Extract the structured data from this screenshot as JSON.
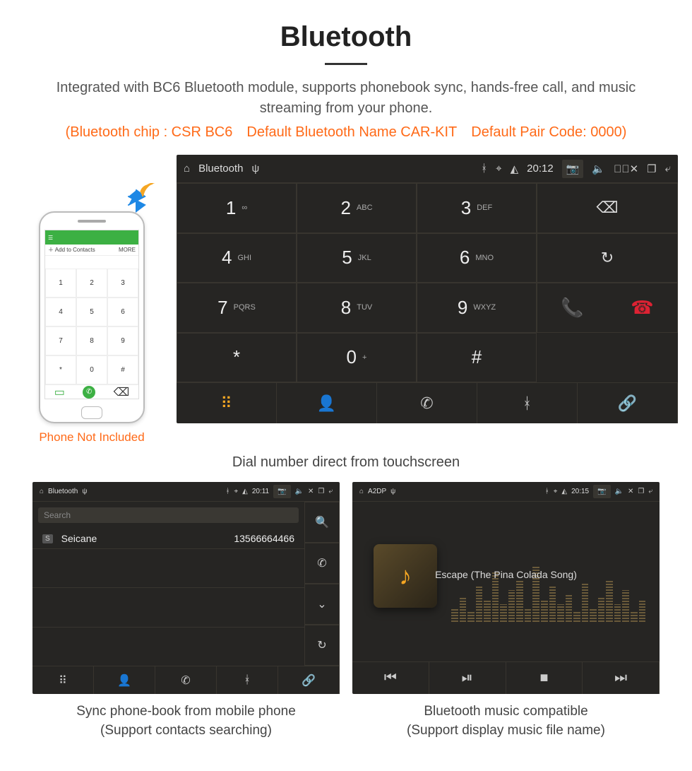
{
  "page": {
    "title": "Bluetooth",
    "subtitle": "Integrated with BC6 Bluetooth module, supports phonebook sync, hands-free call, and music streaming from your phone.",
    "spec_line": "(Bluetooth chip : CSR BC6 Default Bluetooth Name CAR-KIT Default Pair Code: 0000)"
  },
  "phone_mock": {
    "add_contacts": "Add to Contacts",
    "more": "MORE",
    "keys": [
      "1",
      "2",
      "3",
      "4",
      "5",
      "6",
      "7",
      "8",
      "9",
      "*",
      "0",
      "#"
    ],
    "caption": "Phone Not Included"
  },
  "dialer": {
    "status": {
      "title": "Bluetooth",
      "time": "20:12"
    },
    "keys": [
      {
        "n": "1",
        "l": "∞"
      },
      {
        "n": "2",
        "l": "ABC"
      },
      {
        "n": "3",
        "l": "DEF"
      },
      {
        "n": "4",
        "l": "GHI"
      },
      {
        "n": "5",
        "l": "JKL"
      },
      {
        "n": "6",
        "l": "MNO"
      },
      {
        "n": "7",
        "l": "PQRS"
      },
      {
        "n": "8",
        "l": "TUV"
      },
      {
        "n": "9",
        "l": "WXYZ"
      },
      {
        "n": "*",
        "l": ""
      },
      {
        "n": "0",
        "l": "+"
      },
      {
        "n": "#",
        "l": ""
      }
    ],
    "caption": "Dial number direct from touchscreen"
  },
  "phonebook": {
    "status": {
      "title": "Bluetooth",
      "time": "20:11"
    },
    "search_placeholder": "Search",
    "contact": {
      "name": "Seicane",
      "number": "13566664466",
      "tag": "S"
    },
    "caption_l1": "Sync phone-book from mobile phone",
    "caption_l2": "(Support contacts searching)"
  },
  "music": {
    "status": {
      "title": "A2DP",
      "time": "20:15"
    },
    "track": "Escape (The Pina Colada Song)",
    "caption_l1": "Bluetooth music compatible",
    "caption_l2": "(Support display music file name)"
  }
}
